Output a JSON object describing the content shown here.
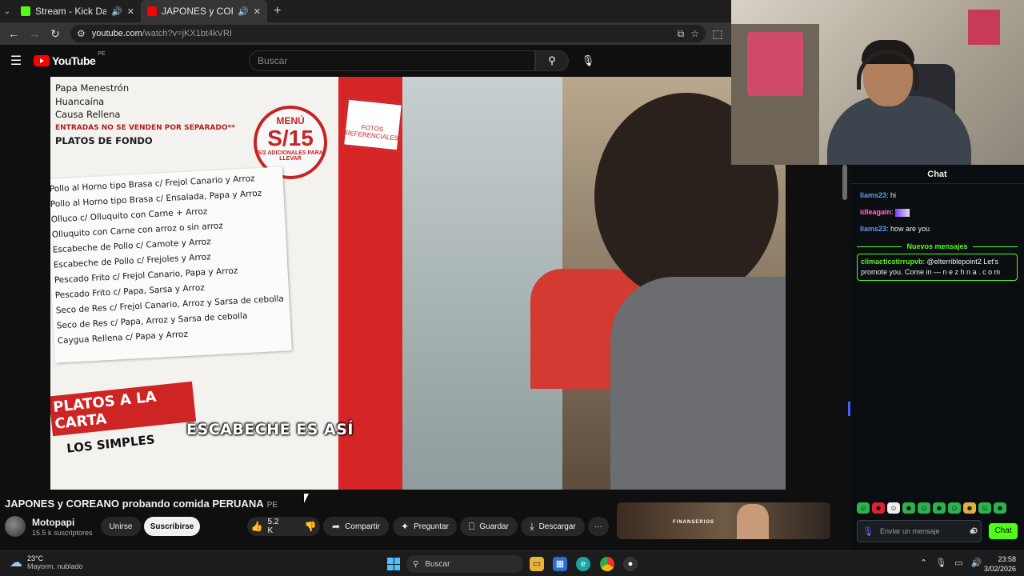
{
  "browser": {
    "tabs": [
      {
        "title": "Stream - Kick Dashboard",
        "favicon_color": "#53fc18",
        "audio": true
      },
      {
        "title": "JAPONES y COREANO probando comida PERUANA",
        "favicon_color": "#ff0000",
        "audio": true
      }
    ],
    "url_host": "youtube.com",
    "url_path": "/watch?v=jKX1bt4kVRI"
  },
  "youtube": {
    "logo_text": "YouTube",
    "logo_country": "PE",
    "search_placeholder": "Buscar"
  },
  "video": {
    "subtitle": "ESCABECHE ES ASÍ",
    "title": "JAPONES y COREANO probando comida PERUANA",
    "title_badge": "PE",
    "channel_name": "Motopapi",
    "channel_subs": "15.5 k suscriptores",
    "join_label": "Unirse",
    "subscribe_label": "Suscribirse",
    "likes": "5.2 K",
    "share_label": "Compartir",
    "ask_label": "Preguntar",
    "save_label": "Guardar",
    "download_label": "Descargar",
    "more_label": "···",
    "menu_scene": {
      "top_lines": [
        "Papa Menestrón",
        "Huancaína",
        "Causa Rellena",
        "ENTRADAS NO SE VENDEN POR SEPARADO**",
        "PLATOS DE FONDO"
      ],
      "menu_sign": [
        "MENÚ",
        "S/15",
        "S/2 ADICIONALES PARA LLEVAR"
      ],
      "list_lines": [
        "Pollo al Horno tipo Brasa c/ Frejol Canario y Arroz",
        "Pollo al Horno tipo Brasa c/ Ensalada, Papa y Arroz",
        "Olluco c/ Olluquito con Carne + Arroz",
        "Olluquito con Carne con arroz o sin arroz",
        "Escabeche de Pollo c/ Camote y Arroz",
        "Escabeche de Pollo c/ Frejoles y Arroz",
        "Pescado Frito c/ Frejol Canario, Papa y Arroz",
        "Pescado Frito c/ Papa, Sarsa y Arroz",
        "Seco de Res c/ Frejol Canario, Arroz y Sarsa de cebolla",
        "Seco de Res c/ Papa, Arroz y Sarsa de cebolla",
        "Caygua Rellena c/ Papa y Arroz"
      ],
      "platos_carta": "PLATOS A LA CARTA",
      "los_simples": "LOS SIMPLES",
      "fotos_sign": "FOTOS REFERENCIALES"
    }
  },
  "recommendation": {
    "label": "FINANSERIOS"
  },
  "chat": {
    "title": "Chat",
    "messages": [
      {
        "user": "liams23",
        "text": "hi",
        "color": "#5b9cf5"
      },
      {
        "user": "idleagain",
        "text": "",
        "color": "#ff6ad5",
        "emote": true
      },
      {
        "user": "liams23",
        "text": "how are you",
        "color": "#5b9cf5"
      }
    ],
    "new_messages_label": "Nuevos mensajes",
    "highlight": {
      "user": "climacticstirrupvb",
      "text": "@elterriblepoint2 Let's promote you. Come in — n e z h n a . c o m"
    },
    "input_placeholder": "Enviar un mensaje",
    "send_label": "Chat",
    "emotes": [
      "emote-1",
      "emote-2",
      "emote-3",
      "emote-4",
      "emote-5",
      "emote-6",
      "emote-7",
      "emote-8",
      "emote-9",
      "emote-10"
    ]
  },
  "taskbar": {
    "temperature": "23°C",
    "weather_desc": "Mayorm. nublado",
    "search_label": "Buscar",
    "time": "23:58",
    "date": "3/02/2026"
  }
}
